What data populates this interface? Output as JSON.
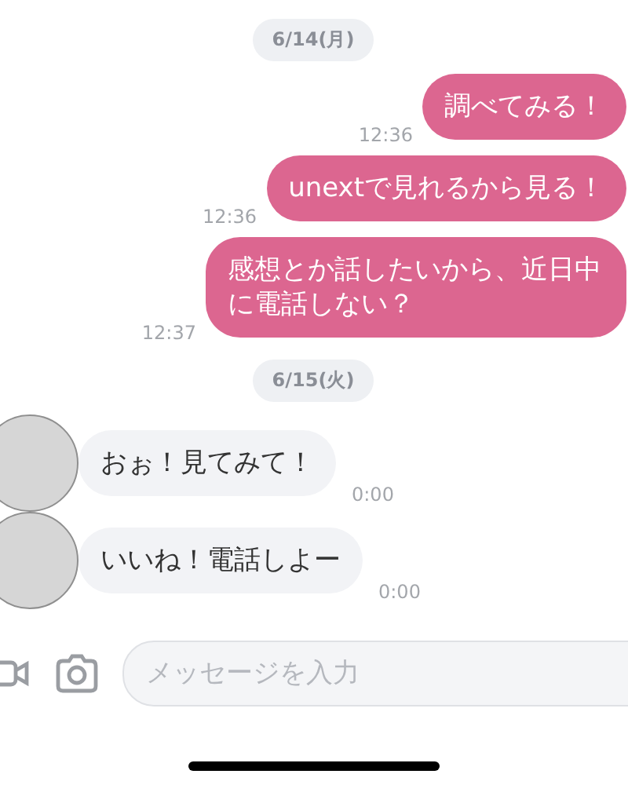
{
  "messages": [
    {
      "kind": "date",
      "text": "6/14(月)"
    },
    {
      "kind": "sent",
      "text": "調べてみる！",
      "time": "12:36"
    },
    {
      "kind": "sent",
      "text": "unextで見れるから見る！",
      "time": "12:36"
    },
    {
      "kind": "sent",
      "text": "感想とか話したいから、近日中に電話しない？",
      "time": "12:37"
    },
    {
      "kind": "date",
      "text": "6/15(火)"
    },
    {
      "kind": "received",
      "text": "おぉ！見てみて！",
      "time": "0:00"
    },
    {
      "kind": "received",
      "text": "いいね！電話しよー",
      "time": "0:00"
    }
  ],
  "composer": {
    "placeholder": "メッセージを入力"
  }
}
